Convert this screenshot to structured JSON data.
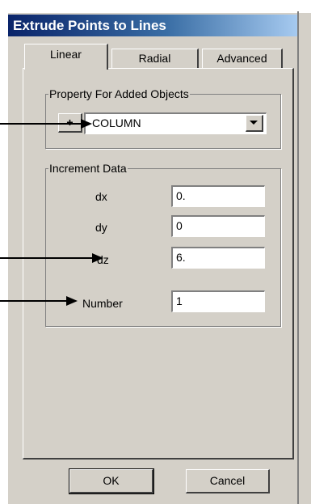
{
  "window": {
    "title": "Extrude Points to Lines"
  },
  "tabs": [
    {
      "label": "Linear"
    },
    {
      "label": "Radial"
    },
    {
      "label": "Advanced"
    }
  ],
  "property_group": {
    "legend": "Property For Added Objects",
    "plus_label": "+",
    "selected": "COLUMN"
  },
  "increment_group": {
    "legend": "Increment Data",
    "dx": {
      "label": "dx",
      "value": "0."
    },
    "dy": {
      "label": "dy",
      "value": "0"
    },
    "dz": {
      "label": "dz",
      "value": "6."
    },
    "number": {
      "label": "Number",
      "value": "1"
    }
  },
  "buttons": {
    "ok": "OK",
    "cancel": "Cancel"
  }
}
